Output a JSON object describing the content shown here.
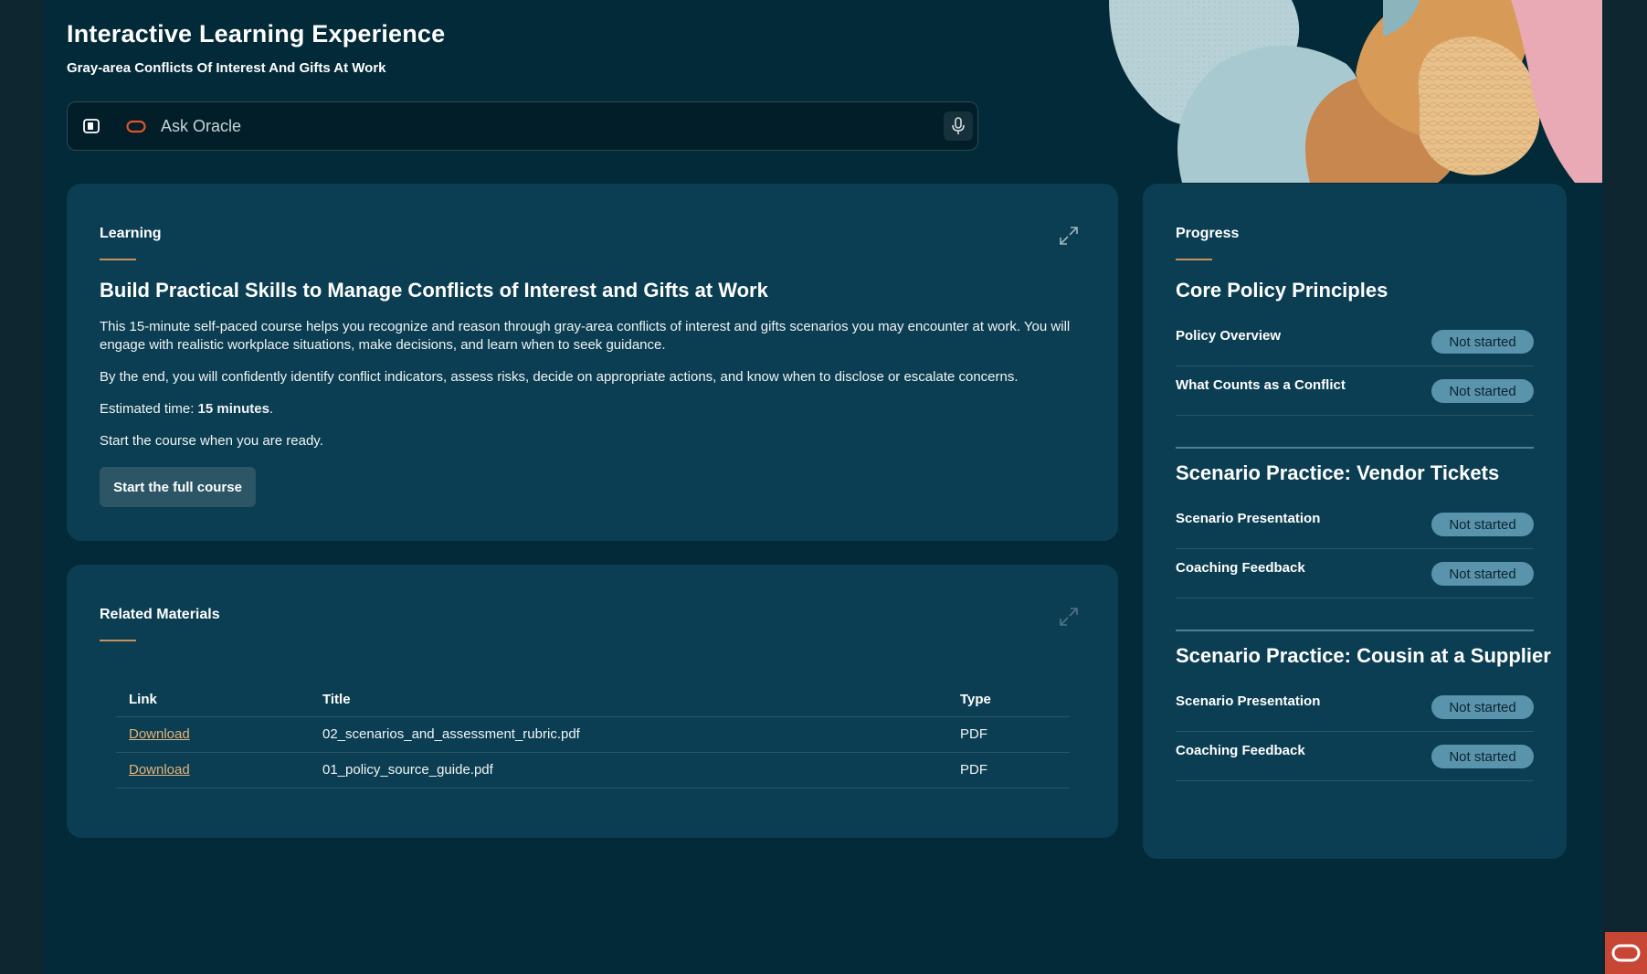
{
  "header": {
    "title": "Interactive Learning Experience",
    "subtitle": "Gray-area Conflicts Of Interest And Gifts At Work"
  },
  "ask": {
    "placeholder": "Ask Oracle",
    "icons": [
      "side-panel-icon",
      "oracle-logo-icon",
      "microphone-icon"
    ]
  },
  "learning": {
    "label": "Learning",
    "heading": "Build Practical Skills to Manage Conflicts of Interest and Gifts at Work",
    "para1": "This 15-minute self-paced course helps you recognize and reason through gray-area conflicts of interest and gifts scenarios you may encounter at work. You will engage with realistic workplace situations, make decisions, and learn when to seek guidance.",
    "para2": "By the end, you will confidently identify conflict indicators, assess risks, decide on appropriate actions, and know when to disclose or escalate concerns.",
    "estimate_label": "Estimated time: ",
    "estimate_value": "15 minutes",
    "estimate_suffix": ".",
    "para4": "Start the course when you are ready.",
    "start_button": "Start the full course"
  },
  "related": {
    "label": "Related Materials",
    "columns": [
      "Link",
      "Title",
      "Type"
    ],
    "rows": [
      {
        "link": "Download",
        "title": "02_scenarios_and_assessment_rubric.pdf",
        "type": "PDF"
      },
      {
        "link": "Download",
        "title": "01_policy_source_guide.pdf",
        "type": "PDF"
      }
    ]
  },
  "progress": {
    "label": "Progress",
    "sections": [
      {
        "title": "Core Policy Principles",
        "items": [
          {
            "label": "Policy Overview",
            "status": "Not started"
          },
          {
            "label": "What Counts as a Conflict",
            "status": "Not started"
          }
        ]
      },
      {
        "title": "Scenario Practice: Vendor Tickets",
        "items": [
          {
            "label": "Scenario Presentation",
            "status": "Not started"
          },
          {
            "label": "Coaching Feedback",
            "status": "Not started"
          }
        ]
      },
      {
        "title": "Scenario Practice: Cousin at a Supplier",
        "items": [
          {
            "label": "Scenario Presentation",
            "status": "Not started"
          },
          {
            "label": "Coaching Feedback",
            "status": "Not started"
          }
        ]
      }
    ]
  },
  "colors": {
    "background": "#022a38",
    "card": "#0b3e52",
    "accent_underline": "#c9915b",
    "badge": "#5a93ac",
    "link": "#e6b27a",
    "oracle_red": "#c74634"
  }
}
